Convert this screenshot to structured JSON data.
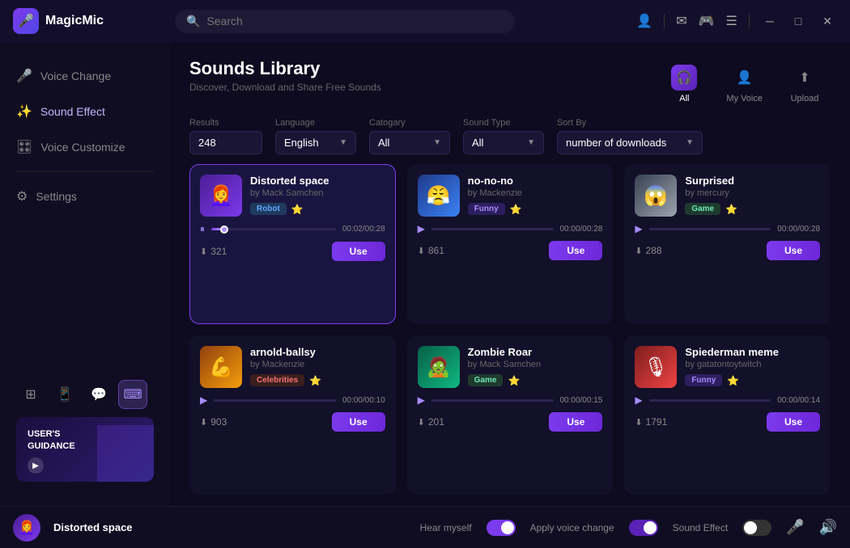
{
  "app": {
    "name": "MagicMic",
    "search_placeholder": "Search"
  },
  "titlebar": {
    "icons": [
      "user",
      "mail",
      "discord",
      "menu"
    ],
    "win_controls": [
      "minimize",
      "maximize",
      "close"
    ]
  },
  "sidebar": {
    "items": [
      {
        "id": "voice-change",
        "label": "Voice Change",
        "icon": "🎤"
      },
      {
        "id": "sound-effect",
        "label": "Sound Effect",
        "icon": "✨",
        "active": true
      },
      {
        "id": "voice-customize",
        "label": "Voice Customize",
        "icon": "🎛"
      },
      {
        "id": "settings",
        "label": "Settings",
        "icon": "⚙"
      }
    ],
    "bottom_tools": [
      {
        "id": "grid",
        "icon": "⊞",
        "active": false
      },
      {
        "id": "phone",
        "icon": "📱",
        "active": false
      },
      {
        "id": "chat",
        "icon": "💬",
        "active": false
      },
      {
        "id": "keyboard",
        "icon": "⌨",
        "active": true
      }
    ],
    "guidance": {
      "line1": "USER'S",
      "line2": "GUIDANCE"
    }
  },
  "page": {
    "title": "Sounds Library",
    "subtitle": "Discover, Download and Share Free Sounds"
  },
  "tabs": [
    {
      "id": "all",
      "label": "All",
      "icon": "🎧",
      "active": true
    },
    {
      "id": "my-voice",
      "label": "My Voice",
      "icon": "👤",
      "active": false
    },
    {
      "id": "upload",
      "label": "Upload",
      "icon": "⬆",
      "active": false
    }
  ],
  "filters": {
    "results_label": "Results",
    "results_value": "248",
    "language_label": "Language",
    "language_value": "English",
    "category_label": "Catogary",
    "category_value": "All",
    "sound_type_label": "Sound Type",
    "sound_type_value": "All",
    "sort_label": "Sort By",
    "sort_value": "number of downloads"
  },
  "sounds": [
    {
      "id": 1,
      "title": "Distorted space",
      "author": "by Mack Samchen",
      "tag": "Robot",
      "tag_type": "robot",
      "downloads": "321",
      "duration": "00:02/00:28",
      "progress": 7,
      "playing": true,
      "use_label": "Use",
      "avatar_emoji": "👩‍🦰",
      "avatar_class": "av-purple"
    },
    {
      "id": 2,
      "title": "no-no-no",
      "author": "by Mackenzie",
      "tag": "Funny",
      "tag_type": "funny",
      "downloads": "861",
      "duration": "00:00/00:28",
      "progress": 0,
      "playing": false,
      "use_label": "Use",
      "avatar_emoji": "😤",
      "avatar_class": "av-blue"
    },
    {
      "id": 3,
      "title": "Surprised",
      "author": "by mercury",
      "tag": "Game",
      "tag_type": "game",
      "downloads": "288",
      "duration": "00:00/00:28",
      "progress": 0,
      "playing": false,
      "use_label": "Use",
      "avatar_emoji": "😱",
      "avatar_class": "av-gray"
    },
    {
      "id": 4,
      "title": "arnold-ballsy",
      "author": "by Mackenzie",
      "tag": "Celebrities",
      "tag_type": "celebrities",
      "downloads": "903",
      "duration": "00:00/00:10",
      "progress": 0,
      "playing": false,
      "use_label": "Use",
      "avatar_emoji": "💪",
      "avatar_class": "av-orange"
    },
    {
      "id": 5,
      "title": "Zombie Roar",
      "author": "by Mack Samchen",
      "tag": "Game",
      "tag_type": "game",
      "downloads": "201",
      "duration": "00:00/00:15",
      "progress": 0,
      "playing": false,
      "use_label": "Use",
      "avatar_emoji": "🧟",
      "avatar_class": "av-green"
    },
    {
      "id": 6,
      "title": "Spiederman meme",
      "author": "by gatatontoytwitch",
      "tag": "Funny",
      "tag_type": "funny",
      "downloads": "1791",
      "duration": "00:00/00:14",
      "progress": 0,
      "playing": false,
      "use_label": "Use",
      "avatar_emoji": "🎙",
      "avatar_class": "av-red"
    }
  ],
  "bottom_bar": {
    "now_playing": "Distorted space",
    "hear_myself_label": "Hear myself",
    "apply_voice_label": "Apply voice change",
    "sound_effect_label": "Sound Effect",
    "hear_myself_on": true,
    "apply_voice_on": true,
    "sound_effect_on": false
  }
}
